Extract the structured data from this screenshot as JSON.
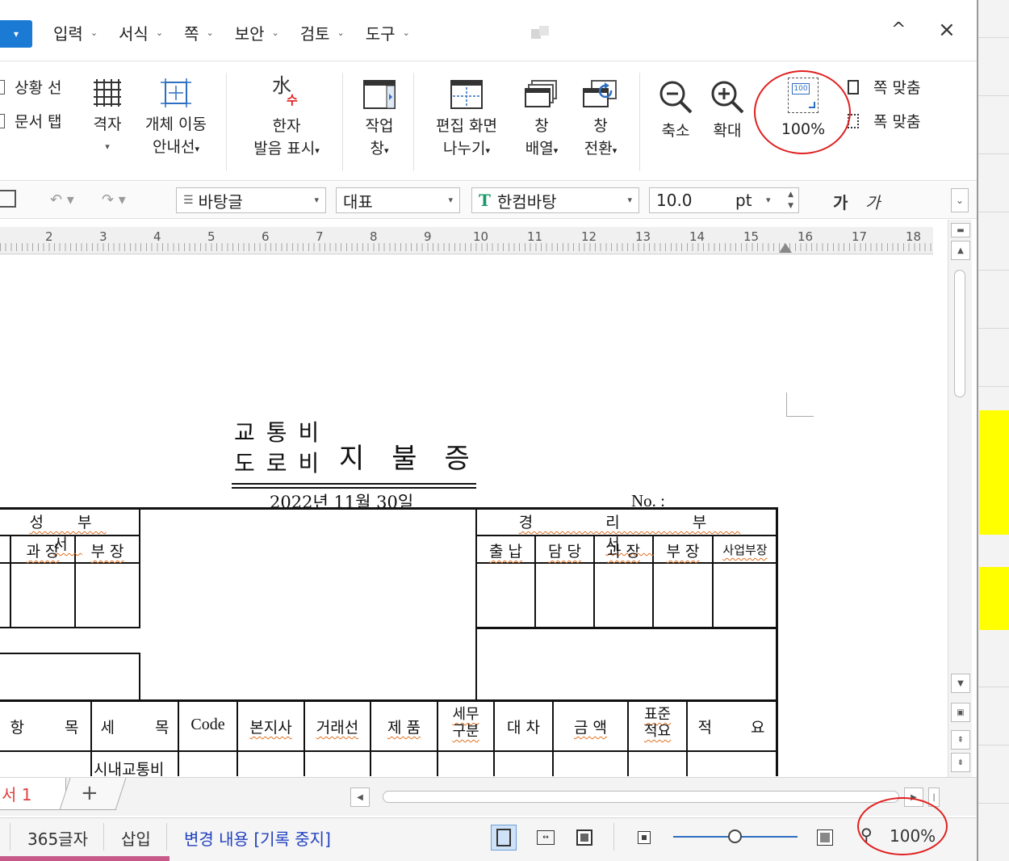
{
  "menubar": {
    "items": [
      "입력",
      "서식",
      "쪽",
      "보안",
      "검토",
      "도구"
    ],
    "collapse_glyph": "^",
    "close_glyph": "×"
  },
  "ribbon": {
    "situation_line": "상황 선",
    "doc_tab": "문서 탭",
    "grid": "격자",
    "object_guide_1": "개체 이동",
    "object_guide_2": "안내선",
    "hanja_1": "한자",
    "hanja_2": "발음 표시",
    "hanja_icon_top": "水",
    "hanja_icon_bottom": "수",
    "task_pane_1": "작업",
    "task_pane_2": "창",
    "split_1": "편집 화면",
    "split_2": "나누기",
    "arrange_1": "창",
    "arrange_2": "배열",
    "switch_1": "창",
    "switch_2": "전환",
    "zoom_out": "축소",
    "zoom_in": "확대",
    "zoom_100": "100%",
    "zoom_100_icon_text": "100",
    "fit_page": "쪽 맞춤",
    "fit_width": "폭 맞춤"
  },
  "format_toolbar": {
    "style": "바탕글",
    "para": "대표",
    "font": "한컴바탕",
    "font_icon": "Ꞁ",
    "size": "10.0",
    "unit": "pt",
    "bold": "가",
    "italic": "가"
  },
  "ruler": {
    "numbers": [
      "2",
      "3",
      "4",
      "5",
      "6",
      "7",
      "8",
      "9",
      "10",
      "11",
      "12",
      "13",
      "14",
      "15",
      "16",
      "17",
      "18"
    ]
  },
  "document": {
    "title_top": "교통비",
    "title_bottom": "도로비",
    "title_main": "지불증",
    "date": "2022년 11월 30일",
    "no_label": "No. :",
    "left_header": "성 부 서",
    "left_sub": [
      "과 장",
      "부 장"
    ],
    "right_header": "경 리 부 서",
    "right_sub": [
      "출 납",
      "담 당",
      "과 장",
      "부 장",
      "사업부장"
    ],
    "columns": [
      "항 목",
      "세 목",
      "Code",
      "본지사",
      "거래선",
      "제 품",
      "세무\n구분",
      "대 차",
      "금 액",
      "표준\n적요",
      "적 요"
    ],
    "row1_cell": "시내교통비"
  },
  "tabs": {
    "doc_tab": "서 1",
    "add": "+"
  },
  "status": {
    "char_count": "365글자",
    "insert_mode": "삽입",
    "track_changes": "변경 내용 [기록 중지]",
    "zoom": "100%"
  },
  "colors": {
    "accent": "#1a7ad4",
    "callout": "#e02020",
    "highlight": "#ffff00",
    "track_text": "#2040c0"
  }
}
